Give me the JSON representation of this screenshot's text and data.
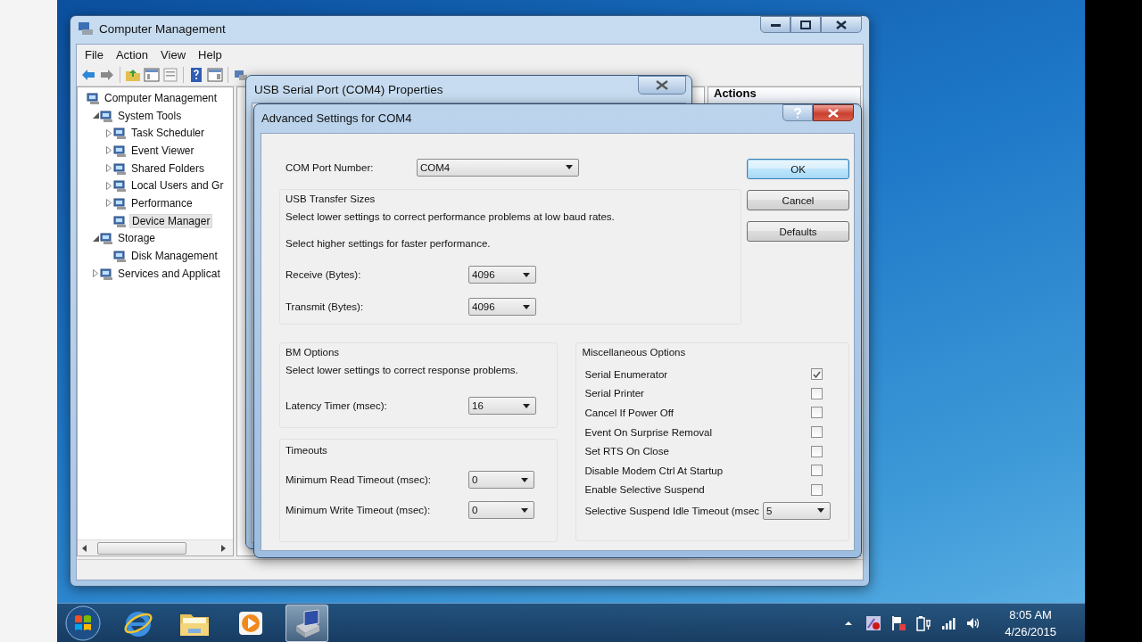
{
  "computer_management": {
    "title": "Computer Management",
    "menu": [
      "File",
      "Action",
      "View",
      "Help"
    ],
    "tree": [
      {
        "label": "Computer Management",
        "selected": false,
        "children": [
          {
            "label": "System Tools",
            "expanded": true,
            "selected": false,
            "children": [
              {
                "label": "Task Scheduler",
                "expanded": false,
                "selected": false
              },
              {
                "label": "Event Viewer",
                "expanded": false,
                "selected": false
              },
              {
                "label": "Shared Folders",
                "expanded": false,
                "selected": false
              },
              {
                "label": "Local Users and Gr",
                "expanded": false,
                "selected": false
              },
              {
                "label": "Performance",
                "expanded": false,
                "selected": false
              },
              {
                "label": "Device Manager",
                "selected": true
              }
            ]
          },
          {
            "label": "Storage",
            "expanded": true,
            "selected": false,
            "children": [
              {
                "label": "Disk Management",
                "selected": false
              }
            ]
          },
          {
            "label": "Services and Applicat",
            "expanded": false,
            "selected": false
          }
        ]
      }
    ],
    "actions_header": "Actions"
  },
  "properties_window": {
    "title": "USB Serial Port (COM4) Properties"
  },
  "advanced_dialog": {
    "title": "Advanced Settings for COM4",
    "com_port": {
      "label": "COM Port Number:",
      "value": "COM4"
    },
    "transfer": {
      "title": "USB Transfer Sizes",
      "notes": [
        "Select lower settings to correct performance problems at low baud rates.",
        "Select higher settings for faster performance."
      ],
      "fields": [
        {
          "label": "Receive (Bytes):",
          "value": "4096"
        },
        {
          "label": "Transmit (Bytes):",
          "value": "4096"
        }
      ]
    },
    "bm_options": {
      "title": "BM Options",
      "note": "Select lower settings to correct response problems.",
      "fields": [
        {
          "label": "Latency Timer (msec):",
          "value": "16"
        }
      ]
    },
    "timeouts": {
      "title": "Timeouts",
      "fields": [
        {
          "label": "Minimum Read Timeout (msec):",
          "value": "0"
        },
        {
          "label": "Minimum Write Timeout (msec):",
          "value": "0"
        }
      ]
    },
    "misc": {
      "title": "Miscellaneous Options",
      "options": [
        {
          "kind": "checkbox",
          "label": "Serial Enumerator",
          "checked": true
        },
        {
          "kind": "checkbox",
          "label": "Serial Printer",
          "checked": false
        },
        {
          "kind": "checkbox",
          "label": "Cancel If Power Off",
          "checked": false
        },
        {
          "kind": "checkbox",
          "label": "Event On Surprise Removal",
          "checked": false
        },
        {
          "kind": "checkbox",
          "label": "Set RTS On Close",
          "checked": false
        },
        {
          "kind": "checkbox",
          "label": "Disable Modem Ctrl At Startup",
          "checked": false
        },
        {
          "kind": "checkbox",
          "label": "Enable Selective Suspend",
          "checked": false
        },
        {
          "kind": "dropdown",
          "label": "Selective Suspend Idle Timeout (msec",
          "value": "5"
        }
      ]
    },
    "buttons": [
      {
        "label": "OK",
        "default": true
      },
      {
        "label": "Cancel",
        "default": false
      },
      {
        "label": "Defaults",
        "default": false
      }
    ]
  },
  "taskbar": {
    "apps": [
      {
        "kind": "browser",
        "active": false
      },
      {
        "kind": "folder",
        "active": false
      },
      {
        "kind": "media",
        "active": false
      },
      {
        "kind": "device-manager",
        "active": true
      }
    ],
    "clock": {
      "time": "8:05 AM",
      "date": "4/26/2015"
    }
  }
}
